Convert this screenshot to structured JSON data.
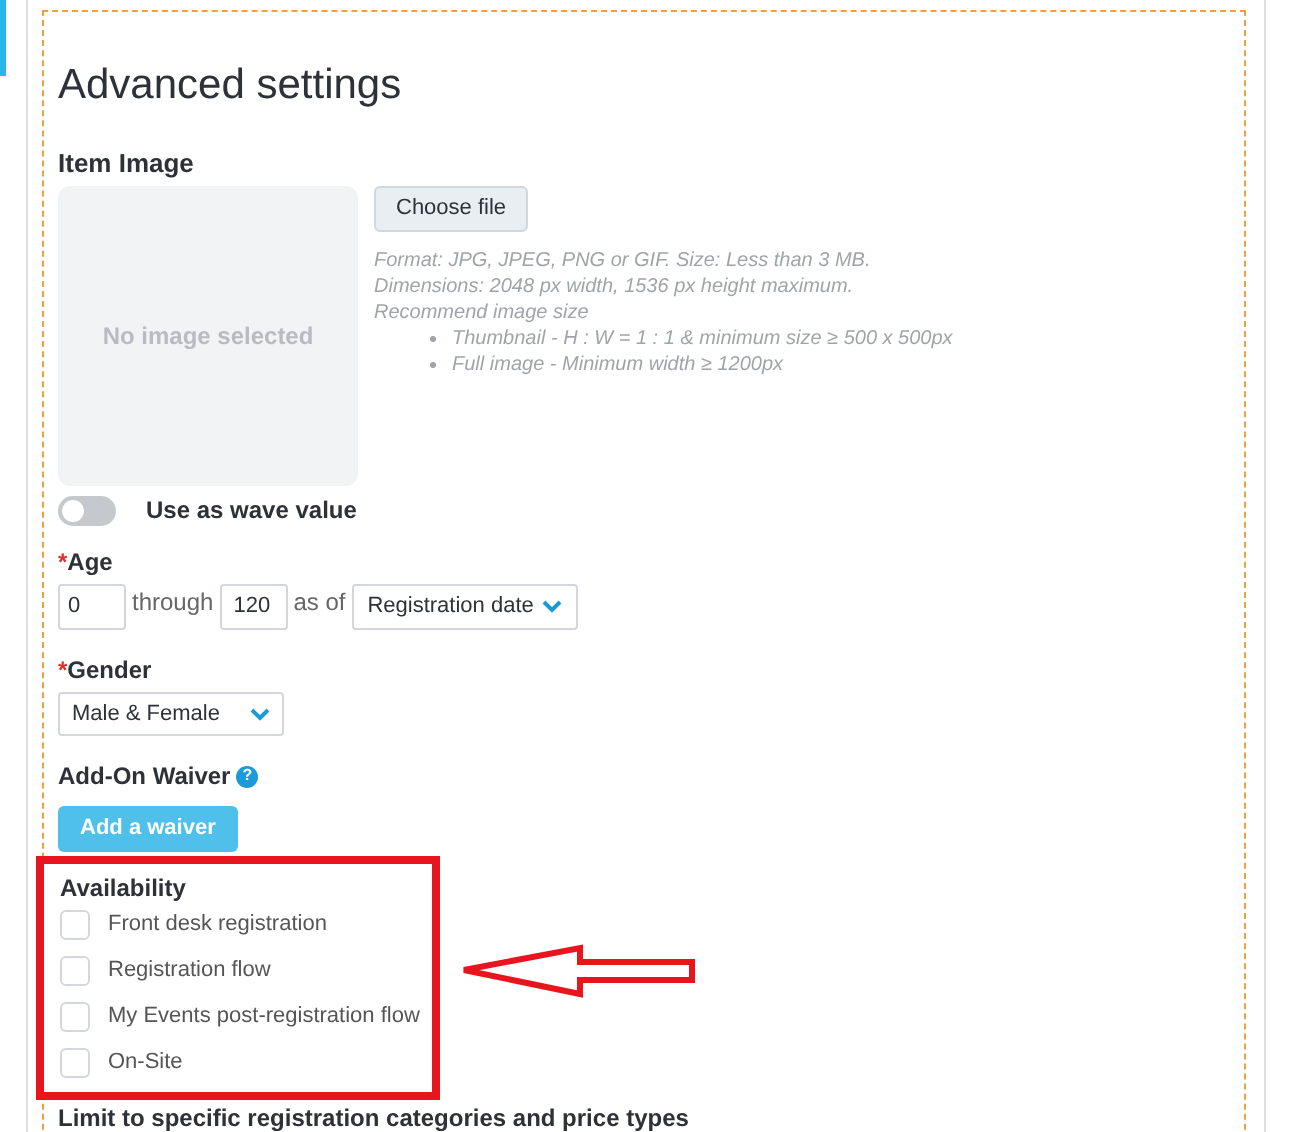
{
  "title": "Advanced settings",
  "item_image": {
    "label": "Item Image",
    "empty_text": "No image selected",
    "button": "Choose file",
    "help": [
      "Format: JPG, JPEG, PNG or GIF. Size: Less than 3 MB.",
      "Dimensions: 2048 px width, 1536 px height maximum.",
      "Recommend image size"
    ],
    "help_bullets": [
      "Thumbnail - H : W = 1 : 1 & minimum size ≥ 500 x 500px",
      "Full image - Minimum width ≥ 1200px"
    ]
  },
  "wave_toggle": {
    "label": "Use as wave value",
    "on": false
  },
  "age": {
    "required_mark": "*",
    "label": "Age",
    "from": "0",
    "through_label": "through",
    "to": "120",
    "as_of_label": "as of",
    "as_of": "Registration date"
  },
  "gender": {
    "required_mark": "*",
    "label": "Gender",
    "value": "Male & Female"
  },
  "waiver": {
    "label": "Add-On Waiver",
    "help_icon": "?",
    "button": "Add a waiver"
  },
  "availability": {
    "label": "Availability",
    "options": [
      {
        "label": "Front desk registration",
        "checked": false
      },
      {
        "label": "Registration flow",
        "checked": false
      },
      {
        "label": "My Events post-registration flow",
        "checked": false
      },
      {
        "label": "On-Site",
        "checked": false
      }
    ]
  },
  "next_section": "Limit to specific registration categories and price types"
}
